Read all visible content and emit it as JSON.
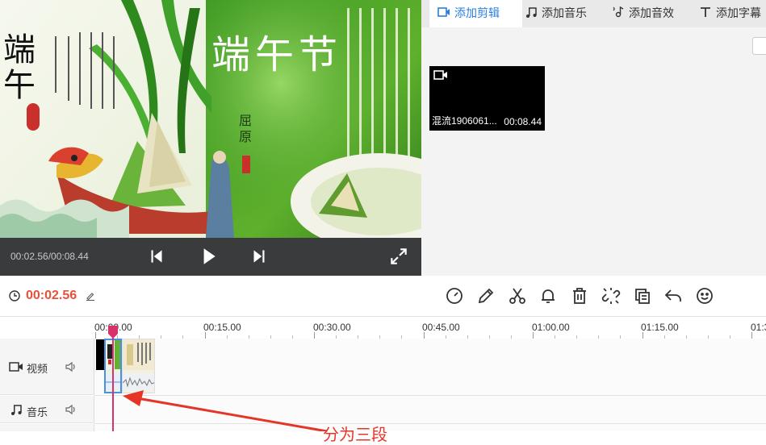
{
  "preview": {
    "title_art": "端午节",
    "side_text": "端午",
    "seal_text": "屈原",
    "time_readout": "00:02.56/00:08.44"
  },
  "tabs": [
    {
      "label": "添加剪辑",
      "icon": "video-camera-icon",
      "active": true
    },
    {
      "label": "添加音乐",
      "icon": "music-note-icon",
      "active": false
    },
    {
      "label": "添加音效",
      "icon": "sound-effect-icon",
      "active": false
    },
    {
      "label": "添加字幕",
      "icon": "text-icon",
      "active": false
    }
  ],
  "media": {
    "name": "混流1906061...",
    "duration": "00:08.44"
  },
  "toolbar": {
    "current_time": "00:02.56",
    "tools": [
      "speed-icon",
      "pencil-icon",
      "scissors-icon",
      "bell-icon",
      "trash-icon",
      "unlink-icon",
      "copy-icon",
      "undo-icon",
      "emoji-icon"
    ]
  },
  "ruler": {
    "labels": [
      "00:00.00",
      "00:15.00",
      "00:30.00",
      "00:45.00",
      "01:00.00",
      "01:15.00",
      "01:3"
    ]
  },
  "tracks": {
    "video_label": "视频",
    "music_label": "音乐"
  },
  "annotation": {
    "text": "分为三段"
  },
  "colors": {
    "accent": "#2b7de1",
    "time_red": "#e8503a",
    "playhead": "#d6336c",
    "annotation_red": "#e53528",
    "control_bar": "#3a3b3d"
  }
}
